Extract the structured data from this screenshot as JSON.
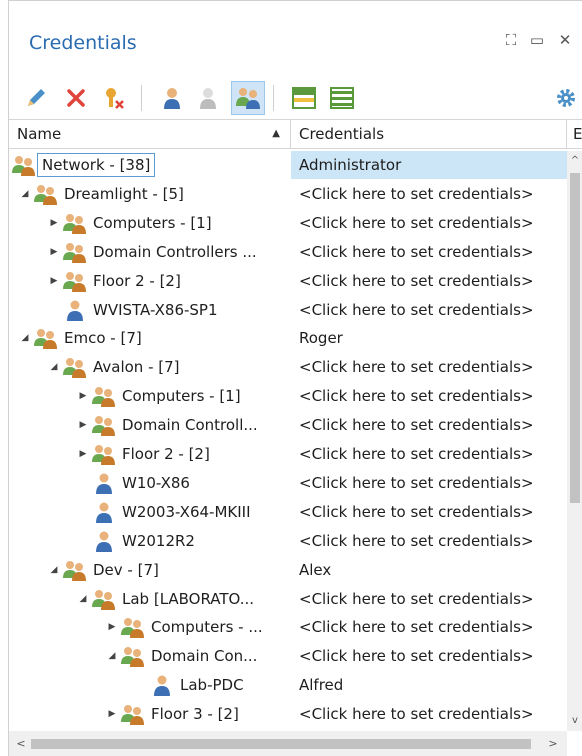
{
  "window": {
    "title": "Credentials"
  },
  "toolbar": {
    "buttons": [
      {
        "icon": "edit-pencil-icon"
      },
      {
        "icon": "delete-x-icon"
      },
      {
        "icon": "clear-credentials-icon"
      },
      {
        "icon": "single-user-icon"
      },
      {
        "icon": "single-user-disabled-icon"
      },
      {
        "icon": "user-group-icon",
        "active": true
      },
      {
        "icon": "grid-lines-icon"
      },
      {
        "icon": "grid-rows-icon"
      },
      {
        "icon": "settings-gear-icon"
      }
    ]
  },
  "columns": {
    "name": "Name",
    "credentials": "Credentials",
    "extra": "E"
  },
  "rows": [
    {
      "label": "Network - [38]",
      "cred": "Administrator",
      "level": 0,
      "expander": "",
      "type": "group",
      "selected": true
    },
    {
      "label": "Dreamlight - [5]",
      "cred": "<Click here to set credentials>",
      "level": 1,
      "expander": "open",
      "type": "group"
    },
    {
      "label": "Computers - [1]",
      "cred": "<Click here to set credentials>",
      "level": 2,
      "expander": "closed",
      "type": "group"
    },
    {
      "label": "Domain Controllers ...",
      "cred": "<Click here to set credentials>",
      "level": 2,
      "expander": "closed",
      "type": "group"
    },
    {
      "label": "Floor 2 - [2]",
      "cred": "<Click here to set credentials>",
      "level": 2,
      "expander": "closed",
      "type": "group"
    },
    {
      "label": "WVISTA-X86-SP1",
      "cred": "<Click here to set credentials>",
      "level": 2,
      "expander": "",
      "type": "user"
    },
    {
      "label": "Emco - [7]",
      "cred": "Roger",
      "level": 1,
      "expander": "open",
      "type": "group"
    },
    {
      "label": "Avalon - [7]",
      "cred": "<Click here to set credentials>",
      "level": 2,
      "expander": "open",
      "type": "group"
    },
    {
      "label": "Computers - [1]",
      "cred": "<Click here to set credentials>",
      "level": 3,
      "expander": "closed",
      "type": "group"
    },
    {
      "label": "Domain Controll...",
      "cred": "<Click here to set credentials>",
      "level": 3,
      "expander": "closed",
      "type": "group"
    },
    {
      "label": "Floor 2 - [2]",
      "cred": "<Click here to set credentials>",
      "level": 3,
      "expander": "closed",
      "type": "group"
    },
    {
      "label": "W10-X86",
      "cred": "<Click here to set credentials>",
      "level": 3,
      "expander": "",
      "type": "user"
    },
    {
      "label": "W2003-X64-MKIII",
      "cred": "<Click here to set credentials>",
      "level": 3,
      "expander": "",
      "type": "user"
    },
    {
      "label": "W2012R2",
      "cred": "<Click here to set credentials>",
      "level": 3,
      "expander": "",
      "type": "user"
    },
    {
      "label": "Dev - [7]",
      "cred": "Alex",
      "level": 2,
      "expander": "open",
      "type": "group"
    },
    {
      "label": "Lab [LABORATO...",
      "cred": "<Click here to set credentials>",
      "level": 3,
      "expander": "open",
      "type": "group"
    },
    {
      "label": "Computers - ...",
      "cred": "<Click here to set credentials>",
      "level": 4,
      "expander": "closed",
      "type": "group"
    },
    {
      "label": "Domain Con...",
      "cred": "<Click here to set credentials>",
      "level": 4,
      "expander": "open",
      "type": "group"
    },
    {
      "label": "Lab-PDC",
      "cred": "Alfred",
      "level": 5,
      "expander": "",
      "type": "user"
    },
    {
      "label": "Floor 3 - [2]",
      "cred": "<Click here to set credentials>",
      "level": 4,
      "expander": "closed",
      "type": "group"
    }
  ],
  "colors": {
    "title": "#2b6cb0",
    "selection": "#cde6f7",
    "accent_border": "#5b9bd5"
  }
}
